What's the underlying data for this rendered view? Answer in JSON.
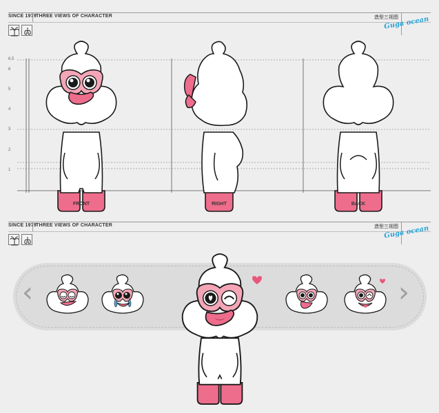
{
  "header": {
    "since": "SINCE 1979",
    "title": "THREE VIEWS OF CHARACTER",
    "cn_title": "造型三视图",
    "brand": "Guga ocean"
  },
  "ruler": {
    "ticks": [
      "6.5",
      "6",
      "5",
      "4",
      "3",
      "2",
      "1"
    ]
  },
  "views": {
    "front": "FRONT",
    "right": "RIGHT",
    "back": "BACK"
  },
  "carousel": {
    "prev_icon": "chevron-left-icon",
    "next_icon": "chevron-right-icon",
    "expressions": [
      "goggles-neutral",
      "crying",
      "wink-heart",
      "surprised",
      "wink-tongue"
    ]
  },
  "colors": {
    "pink": "#ee6d8c",
    "pink_light": "#f4a6b7",
    "outline": "#1a1a1a",
    "heart": "#e9577a",
    "brand": "#29a3d6"
  }
}
